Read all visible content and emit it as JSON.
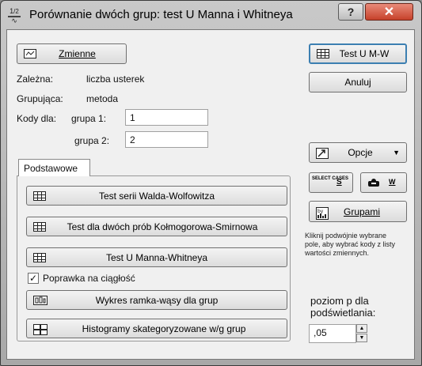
{
  "window": {
    "title": "Porównanie dwóch grup: test U Manna i Whitneya",
    "help_label": "?",
    "close_label": "✕"
  },
  "buttons": {
    "zmienne": "Zmienne",
    "test_umw": "Test U M-W",
    "anuluj": "Anuluj",
    "opcje": "Opcje",
    "select_cases": "SELECT CASES",
    "s": "S",
    "w": "W",
    "grupami": "Grupami"
  },
  "variables": {
    "zalezna_label": "Zależna:",
    "zalezna_value": "liczba usterek",
    "grupujaca_label": "Grupująca:",
    "grupujaca_value": "metoda"
  },
  "codes": {
    "label": "Kody dla:",
    "group1_label": "grupa 1:",
    "group1_value": "1",
    "group2_label": "grupa 2:",
    "group2_value": "2"
  },
  "tab": {
    "label": "Podstawowe"
  },
  "tests": {
    "wald": "Test serii Walda-Wolfowitza",
    "ks": "Test dla dwóch prób Kołmogorowa-Smirnowa",
    "mw": "Test U Manna-Whitneya",
    "continuity_label": "Poprawka na ciągłość",
    "continuity_checked": true,
    "boxplot": "Wykres ramka-wąsy dla grup",
    "histograms": "Histogramy skategoryzowane w/g grup"
  },
  "hint": {
    "line1": "Kliknij podwójnie wybrane",
    "line2": "pole, aby wybrać kody z listy",
    "line3": "wartości  zmiennych."
  },
  "highlight": {
    "label_line1": "poziom p dla",
    "label_line2": "podświetlania:",
    "value": ",05"
  }
}
